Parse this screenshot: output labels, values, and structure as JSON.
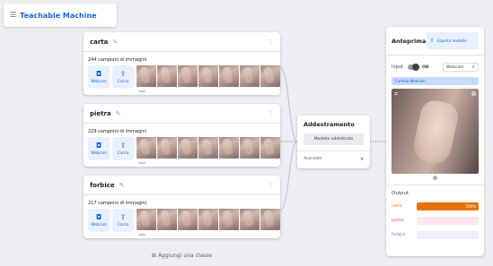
{
  "app": {
    "title": "Teachable Machine"
  },
  "classes": [
    {
      "name": "carta",
      "samples": "244 campioni di immagini"
    },
    {
      "name": "pietra",
      "samples": "229 campioni di immagini"
    },
    {
      "name": "forbice",
      "samples": "217 campioni di immagini"
    }
  ],
  "sample_buttons": {
    "webcam": "Webcam",
    "upload": "Carica"
  },
  "add_class": "Aggiungi una classe",
  "training": {
    "title": "Addestramento",
    "button": "Modello addestrato",
    "advanced": "Avanzate"
  },
  "preview": {
    "title": "Anteprima",
    "export": "Esporta modello",
    "input_label": "Input",
    "toggle_state": "ON",
    "input_source": "Webcam",
    "switch_camera": "Cambia Webcam",
    "output_label": "Output",
    "outputs": [
      {
        "name": "carta",
        "value": "100%",
        "confidence": 1.0,
        "color": "#e8710a",
        "track": "#e8710a"
      },
      {
        "name": "pietra",
        "value": "",
        "confidence": 0.0,
        "color": "#e52592",
        "track": "#fde7ef"
      },
      {
        "name": "forbice",
        "value": "",
        "confidence": 0.0,
        "color": "#7b61ff",
        "track": "#efedfd"
      }
    ]
  },
  "colors": {
    "accent": "#1967d2",
    "accent_light": "#e8f0fe",
    "background": "#eceef1"
  }
}
